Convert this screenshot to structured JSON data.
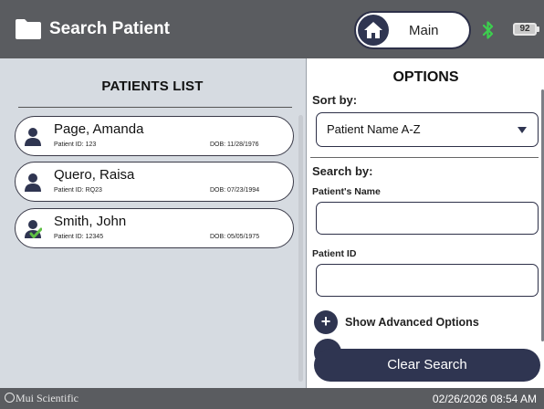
{
  "header": {
    "title": "Search Patient",
    "main_button_label": "Main",
    "battery_level": "92"
  },
  "patients_panel": {
    "title": "PATIENTS LIST",
    "patients": [
      {
        "name": "Page, Amanda",
        "patient_id": "Patient ID: 123",
        "dob": "DOB: 11/28/1976",
        "icon": "person-icon",
        "checked": false
      },
      {
        "name": "Quero, Raisa",
        "patient_id": "Patient ID: RQ23",
        "dob": "DOB: 07/23/1994",
        "icon": "person-icon",
        "checked": false
      },
      {
        "name": "Smith, John",
        "patient_id": "Patient ID: 12345",
        "dob": "DOB: 05/05/1975",
        "icon": "person-check-icon",
        "checked": true
      }
    ]
  },
  "options": {
    "title": "OPTIONS",
    "sort_label": "Sort by:",
    "sort_value": "Patient Name A-Z",
    "search_label": "Search by:",
    "name_field_label": "Patient's Name",
    "name_field_value": "",
    "id_field_label": "Patient ID",
    "id_field_value": "",
    "advanced_label": "Show Advanced Options",
    "clear_button_label": "Clear Search"
  },
  "footer": {
    "brand": "Mui Scientific",
    "datetime": "02/26/2026 08:54 AM"
  },
  "colors": {
    "header_bg": "#5a5c60",
    "navy_accent": "#2f3551",
    "panel_bg": "#d6dbe1",
    "bluetooth": "#3ccf4e",
    "check_green": "#5fbf45"
  }
}
